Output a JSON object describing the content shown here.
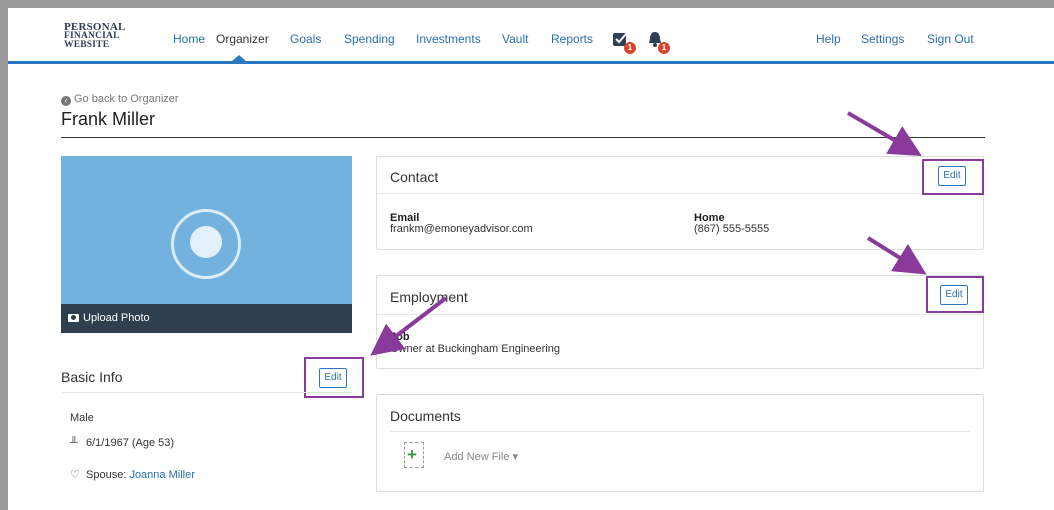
{
  "nav": {
    "logo_lines": [
      "PERSONAL",
      "FINANCIAL",
      "WEBSITE"
    ],
    "links": [
      "Home",
      "Organizer",
      "Goals",
      "Spending",
      "Investments",
      "Vault",
      "Reports"
    ],
    "active": "Organizer",
    "tasks_badge": "1",
    "alerts_badge": "1",
    "right_links": [
      "Help",
      "Settings",
      "Sign Out"
    ]
  },
  "page": {
    "back_link": "Go back to Organizer",
    "title": "Frank Miller"
  },
  "photo": {
    "upload_label": "Upload Photo"
  },
  "basic_info": {
    "title": "Basic Info",
    "edit_label": "Edit",
    "gender": "Male",
    "birthday": "6/1/1967 (Age 53)",
    "spouse_label": "Spouse:",
    "spouse_name": "Joanna Miller"
  },
  "contact": {
    "title": "Contact",
    "edit_label": "Edit",
    "email_label": "Email",
    "email_value": "frankm@emoneyadvisor.com",
    "home_label": "Home",
    "home_value": "(867) 555-5555"
  },
  "employment": {
    "title": "Employment",
    "edit_label": "Edit",
    "job_label": "Job",
    "job_value": "Owner at Buckingham Engineering"
  },
  "documents": {
    "title": "Documents",
    "add_file_label": "Add New File"
  },
  "colors": {
    "nav_accent": "#2a78c0",
    "photo_bg": "#73b2df",
    "upload_bar": "#2f3f4f",
    "highlight": "#8a3a9a",
    "badge": "#d8452f"
  }
}
